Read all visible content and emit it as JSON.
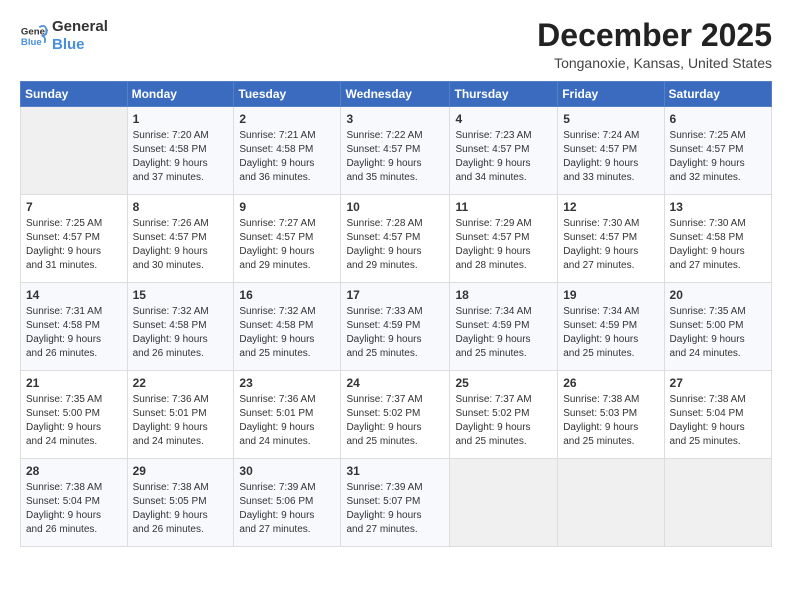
{
  "logo": {
    "line1": "General",
    "line2": "Blue"
  },
  "title": "December 2025",
  "subtitle": "Tonganoxie, Kansas, United States",
  "days_of_week": [
    "Sunday",
    "Monday",
    "Tuesday",
    "Wednesday",
    "Thursday",
    "Friday",
    "Saturday"
  ],
  "weeks": [
    [
      {
        "day": "",
        "info": ""
      },
      {
        "day": "1",
        "info": "Sunrise: 7:20 AM\nSunset: 4:58 PM\nDaylight: 9 hours\nand 37 minutes."
      },
      {
        "day": "2",
        "info": "Sunrise: 7:21 AM\nSunset: 4:58 PM\nDaylight: 9 hours\nand 36 minutes."
      },
      {
        "day": "3",
        "info": "Sunrise: 7:22 AM\nSunset: 4:57 PM\nDaylight: 9 hours\nand 35 minutes."
      },
      {
        "day": "4",
        "info": "Sunrise: 7:23 AM\nSunset: 4:57 PM\nDaylight: 9 hours\nand 34 minutes."
      },
      {
        "day": "5",
        "info": "Sunrise: 7:24 AM\nSunset: 4:57 PM\nDaylight: 9 hours\nand 33 minutes."
      },
      {
        "day": "6",
        "info": "Sunrise: 7:25 AM\nSunset: 4:57 PM\nDaylight: 9 hours\nand 32 minutes."
      }
    ],
    [
      {
        "day": "7",
        "info": "Sunrise: 7:25 AM\nSunset: 4:57 PM\nDaylight: 9 hours\nand 31 minutes."
      },
      {
        "day": "8",
        "info": "Sunrise: 7:26 AM\nSunset: 4:57 PM\nDaylight: 9 hours\nand 30 minutes."
      },
      {
        "day": "9",
        "info": "Sunrise: 7:27 AM\nSunset: 4:57 PM\nDaylight: 9 hours\nand 29 minutes."
      },
      {
        "day": "10",
        "info": "Sunrise: 7:28 AM\nSunset: 4:57 PM\nDaylight: 9 hours\nand 29 minutes."
      },
      {
        "day": "11",
        "info": "Sunrise: 7:29 AM\nSunset: 4:57 PM\nDaylight: 9 hours\nand 28 minutes."
      },
      {
        "day": "12",
        "info": "Sunrise: 7:30 AM\nSunset: 4:57 PM\nDaylight: 9 hours\nand 27 minutes."
      },
      {
        "day": "13",
        "info": "Sunrise: 7:30 AM\nSunset: 4:58 PM\nDaylight: 9 hours\nand 27 minutes."
      }
    ],
    [
      {
        "day": "14",
        "info": "Sunrise: 7:31 AM\nSunset: 4:58 PM\nDaylight: 9 hours\nand 26 minutes."
      },
      {
        "day": "15",
        "info": "Sunrise: 7:32 AM\nSunset: 4:58 PM\nDaylight: 9 hours\nand 26 minutes."
      },
      {
        "day": "16",
        "info": "Sunrise: 7:32 AM\nSunset: 4:58 PM\nDaylight: 9 hours\nand 25 minutes."
      },
      {
        "day": "17",
        "info": "Sunrise: 7:33 AM\nSunset: 4:59 PM\nDaylight: 9 hours\nand 25 minutes."
      },
      {
        "day": "18",
        "info": "Sunrise: 7:34 AM\nSunset: 4:59 PM\nDaylight: 9 hours\nand 25 minutes."
      },
      {
        "day": "19",
        "info": "Sunrise: 7:34 AM\nSunset: 4:59 PM\nDaylight: 9 hours\nand 25 minutes."
      },
      {
        "day": "20",
        "info": "Sunrise: 7:35 AM\nSunset: 5:00 PM\nDaylight: 9 hours\nand 24 minutes."
      }
    ],
    [
      {
        "day": "21",
        "info": "Sunrise: 7:35 AM\nSunset: 5:00 PM\nDaylight: 9 hours\nand 24 minutes."
      },
      {
        "day": "22",
        "info": "Sunrise: 7:36 AM\nSunset: 5:01 PM\nDaylight: 9 hours\nand 24 minutes."
      },
      {
        "day": "23",
        "info": "Sunrise: 7:36 AM\nSunset: 5:01 PM\nDaylight: 9 hours\nand 24 minutes."
      },
      {
        "day": "24",
        "info": "Sunrise: 7:37 AM\nSunset: 5:02 PM\nDaylight: 9 hours\nand 25 minutes."
      },
      {
        "day": "25",
        "info": "Sunrise: 7:37 AM\nSunset: 5:02 PM\nDaylight: 9 hours\nand 25 minutes."
      },
      {
        "day": "26",
        "info": "Sunrise: 7:38 AM\nSunset: 5:03 PM\nDaylight: 9 hours\nand 25 minutes."
      },
      {
        "day": "27",
        "info": "Sunrise: 7:38 AM\nSunset: 5:04 PM\nDaylight: 9 hours\nand 25 minutes."
      }
    ],
    [
      {
        "day": "28",
        "info": "Sunrise: 7:38 AM\nSunset: 5:04 PM\nDaylight: 9 hours\nand 26 minutes."
      },
      {
        "day": "29",
        "info": "Sunrise: 7:38 AM\nSunset: 5:05 PM\nDaylight: 9 hours\nand 26 minutes."
      },
      {
        "day": "30",
        "info": "Sunrise: 7:39 AM\nSunset: 5:06 PM\nDaylight: 9 hours\nand 27 minutes."
      },
      {
        "day": "31",
        "info": "Sunrise: 7:39 AM\nSunset: 5:07 PM\nDaylight: 9 hours\nand 27 minutes."
      },
      {
        "day": "",
        "info": ""
      },
      {
        "day": "",
        "info": ""
      },
      {
        "day": "",
        "info": ""
      }
    ]
  ]
}
